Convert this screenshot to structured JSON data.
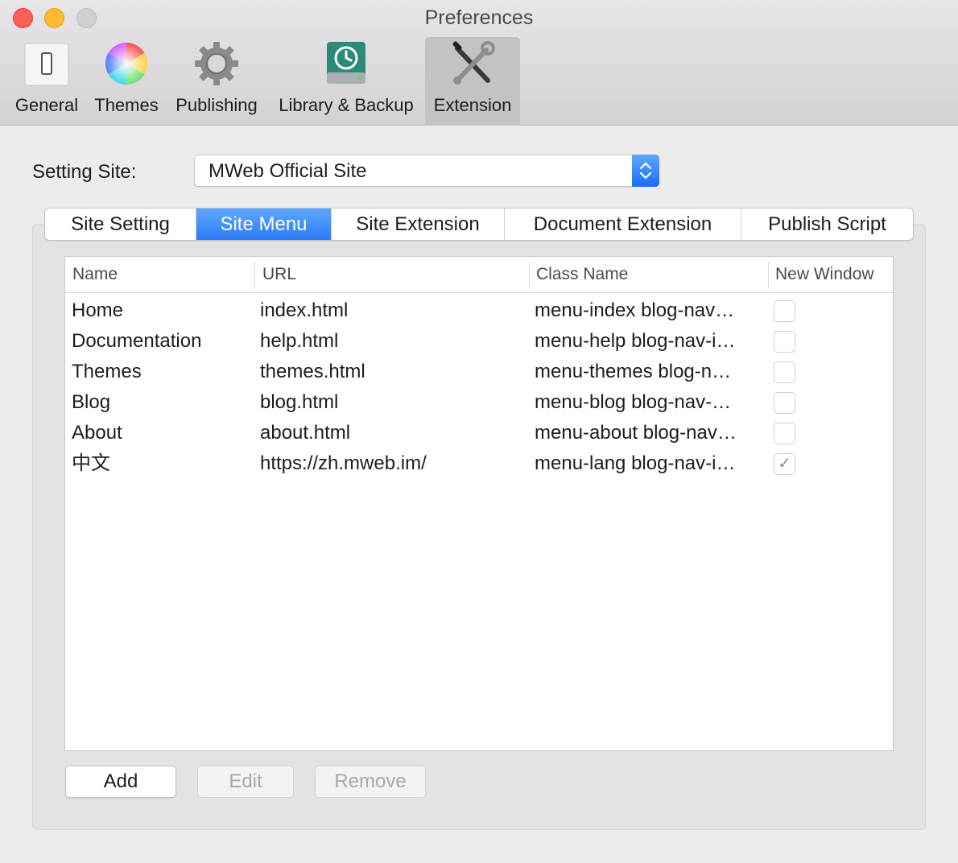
{
  "window": {
    "title": "Preferences"
  },
  "toolbar": {
    "items": [
      {
        "label": "General",
        "icon": "general-switch-icon"
      },
      {
        "label": "Themes",
        "icon": "color-wheel-icon"
      },
      {
        "label": "Publishing",
        "icon": "gear-icon"
      },
      {
        "label": "Library & Backup",
        "icon": "time-machine-drive-icon"
      },
      {
        "label": "Extension",
        "icon": "wrench-screwdriver-icon",
        "active": true
      }
    ]
  },
  "setting_site": {
    "label": "Setting Site:",
    "value": "MWeb Official Site"
  },
  "tabs": [
    {
      "label": "Site Setting"
    },
    {
      "label": "Site Menu",
      "active": true
    },
    {
      "label": "Site Extension"
    },
    {
      "label": "Document Extension"
    },
    {
      "label": "Publish Script"
    }
  ],
  "table": {
    "columns": [
      "Name",
      "URL",
      "Class Name",
      "New Window"
    ],
    "rows": [
      {
        "name": "Home",
        "url": "index.html",
        "class_name": "menu-index blog-nav…",
        "new_window": false
      },
      {
        "name": "Documentation",
        "url": "help.html",
        "class_name": "menu-help blog-nav-i…",
        "new_window": false
      },
      {
        "name": "Themes",
        "url": "themes.html",
        "class_name": "menu-themes blog-n…",
        "new_window": false
      },
      {
        "name": "Blog",
        "url": "blog.html",
        "class_name": "menu-blog blog-nav-…",
        "new_window": false
      },
      {
        "name": "About",
        "url": "about.html",
        "class_name": "menu-about blog-nav…",
        "new_window": false
      },
      {
        "name": "中文",
        "url": "https://zh.mweb.im/",
        "class_name": "menu-lang blog-nav-i…",
        "new_window": true
      }
    ]
  },
  "buttons": {
    "add": "Add",
    "edit": "Edit",
    "remove": "Remove"
  },
  "colors": {
    "accent": "#2a7cf7",
    "close": "#fc5f57",
    "minimize": "#fdbb2e"
  }
}
